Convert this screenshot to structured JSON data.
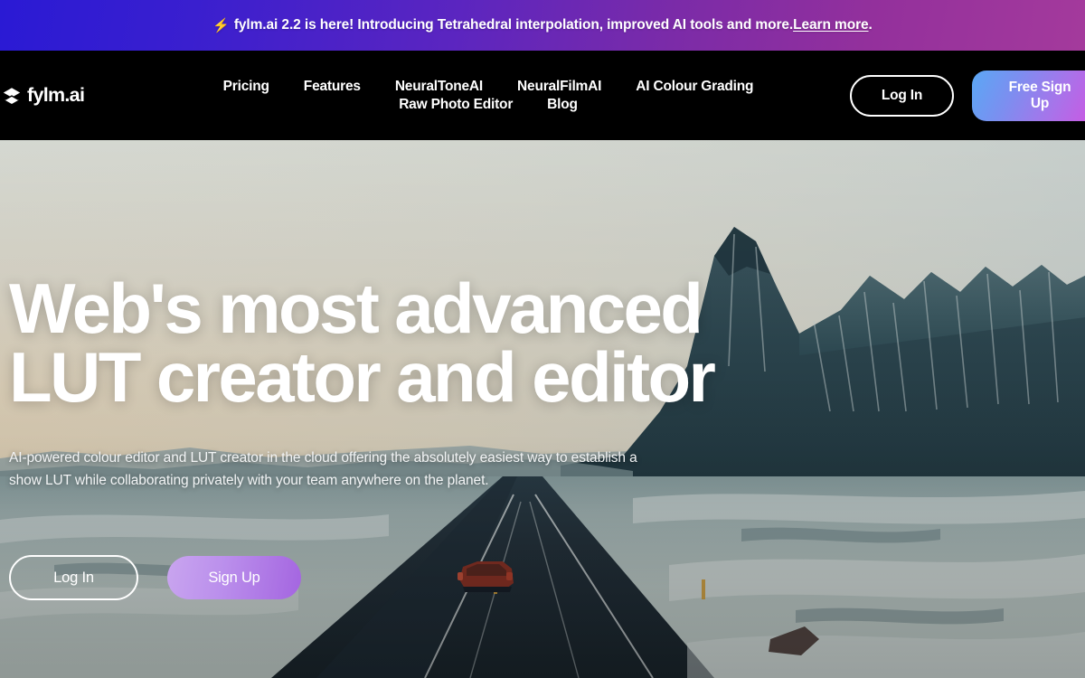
{
  "banner": {
    "icon": "lightning-bolt-icon",
    "text_before": "fylm.ai 2.2 is here! Introducing Tetrahedral interpolation, improved AI tools and more. ",
    "link_label": "Learn more",
    "text_after": ".",
    "gradient_from": "#2a1ad4",
    "gradient_to": "#a43a9c"
  },
  "nav": {
    "logo_icon": "stacked-diamond-logo-icon",
    "logo_text": "fylm.ai",
    "links": [
      {
        "label": "Pricing"
      },
      {
        "label": "Features"
      },
      {
        "label": "NeuralToneAI"
      },
      {
        "label": "NeuralFilmAI"
      },
      {
        "label": "AI Colour Grading"
      },
      {
        "label": "Raw Photo Editor"
      },
      {
        "label": "Blog"
      }
    ],
    "login_label": "Log In",
    "signup_label_line1": "Free Sign",
    "signup_label_line2": "Up",
    "signup_gradient_from": "#5aa8f5",
    "signup_gradient_to": "#d64fe0"
  },
  "hero": {
    "title_line1": "Web's most advanced",
    "title_line2": "LUT creator and editor",
    "subtitle": "AI-powered colour editor and LUT creator in the cloud offering the absolutely easiest way to establish a show LUT while collaborating privately with your team anywhere on the planet.",
    "login_label": "Log In",
    "signup_label": "Sign Up",
    "signup_gradient_from": "#c9a5ef",
    "signup_gradient_to": "#a465e0",
    "background_description": "snowy icelandic road with red car and dark mountains"
  }
}
